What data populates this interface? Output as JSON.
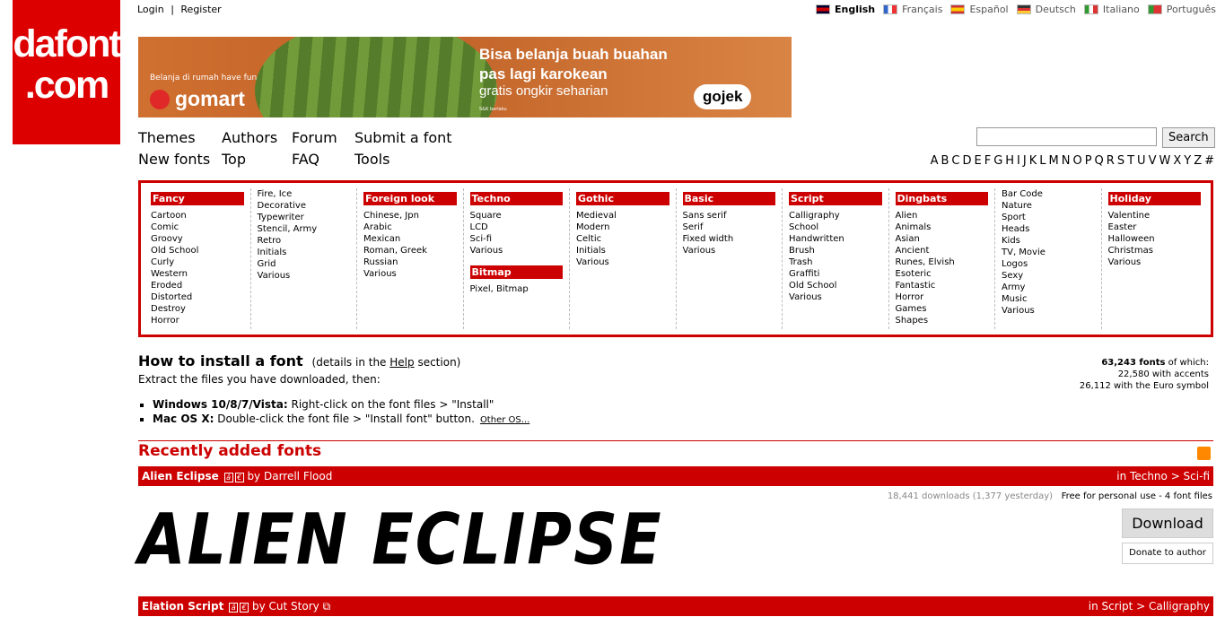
{
  "logo": {
    "line1": "dafont",
    ".line2": ".com",
    "line2": ".com"
  },
  "top_links": {
    "login": "Login",
    "sep": "|",
    "register": "Register"
  },
  "languages": [
    {
      "label": "English",
      "selected": true
    },
    {
      "label": "Français",
      "selected": false
    },
    {
      "label": "Español",
      "selected": false
    },
    {
      "label": "Deutsch",
      "selected": false
    },
    {
      "label": "Italiano",
      "selected": false
    },
    {
      "label": "Português",
      "selected": false
    }
  ],
  "banner": {
    "small": "Belanja di rumah have fun",
    "brand": "gomart",
    "headline1": "Bisa belanja buah buahan",
    "headline2": "pas lagi karokean",
    "sub": "gratis ongkir seharian",
    "gojek": "gojek",
    "tiny": "S&K berlaku"
  },
  "nav": {
    "themes": "Themes",
    "authors": "Authors",
    "forum": "Forum",
    "submit": "Submit a font",
    "newfonts": "New fonts",
    "top": "Top",
    "faq": "FAQ",
    "tools": "Tools"
  },
  "search": {
    "placeholder": "",
    "button": "Search"
  },
  "alphabet": [
    "A",
    "B",
    "C",
    "D",
    "E",
    "F",
    "G",
    "H",
    "I",
    "J",
    "K",
    "L",
    "M",
    "N",
    "O",
    "P",
    "Q",
    "R",
    "S",
    "T",
    "U",
    "V",
    "W",
    "X",
    "Y",
    "Z",
    "#"
  ],
  "categories": {
    "fancy": {
      "title": "Fancy",
      "items": [
        "Cartoon",
        "Comic",
        "Groovy",
        "Old School",
        "Curly",
        "Western",
        "Eroded",
        "Distorted",
        "Destroy",
        "Horror"
      ]
    },
    "fancy2": {
      "items": [
        "Fire, Ice",
        "Decorative",
        "Typewriter",
        "Stencil, Army",
        "Retro",
        "Initials",
        "Grid",
        "Various"
      ]
    },
    "foreign": {
      "title": "Foreign look",
      "items": [
        "Chinese, Jpn",
        "Arabic",
        "Mexican",
        "Roman, Greek",
        "Russian",
        "Various"
      ]
    },
    "techno": {
      "title": "Techno",
      "items": [
        "Square",
        "LCD",
        "Sci-fi",
        "Various"
      ]
    },
    "bitmap": {
      "title": "Bitmap",
      "items": [
        "Pixel, Bitmap"
      ]
    },
    "gothic": {
      "title": "Gothic",
      "items": [
        "Medieval",
        "Modern",
        "Celtic",
        "Initials",
        "Various"
      ]
    },
    "basic": {
      "title": "Basic",
      "items": [
        "Sans serif",
        "Serif",
        "Fixed width",
        "Various"
      ]
    },
    "script": {
      "title": "Script",
      "items": [
        "Calligraphy",
        "School",
        "Handwritten",
        "Brush",
        "Trash",
        "Graffiti",
        "Old School",
        "Various"
      ]
    },
    "dingbats": {
      "title": "Dingbats",
      "items": [
        "Alien",
        "Animals",
        "Asian",
        "Ancient",
        "Runes, Elvish",
        "Esoteric",
        "Fantastic",
        "Horror",
        "Games",
        "Shapes"
      ]
    },
    "dingbats2": {
      "items": [
        "Bar Code",
        "Nature",
        "Sport",
        "Heads",
        "Kids",
        "TV, Movie",
        "Logos",
        "Sexy",
        "Army",
        "Music",
        "Various"
      ]
    },
    "holiday": {
      "title": "Holiday",
      "items": [
        "Valentine",
        "Easter",
        "Halloween",
        "Christmas",
        "Various"
      ]
    }
  },
  "howto": {
    "title": "How to install a font",
    "details_pre": "(details in the",
    "details_link": "Help",
    "details_post": "section)",
    "extract": "Extract the files you have downloaded, then:",
    "win_label": "Windows 10/8/7/Vista:",
    "win_text": "Right-click on the font files > \"Install\"",
    "mac_label": "Mac OS X:",
    "mac_text": "Double-click the font file > \"Install font\" button.",
    "other": "Other OS..."
  },
  "stats": {
    "count": "63,243 fonts",
    "of_which": "of which:",
    "accents": "22,580 with accents",
    "euro": "26,112 with the Euro symbol"
  },
  "recent": {
    "title": "Recently added fonts"
  },
  "font1": {
    "name": "Alien Eclipse",
    "by": "by Darrell Flood",
    "cat": "in Techno > Sci-fi",
    "downloads": "18,441 downloads (1,377 yesterday)",
    "license": "Free for personal use - 4 font files",
    "preview": "ALIEN ECLIPSE",
    "download": "Download",
    "donate": "Donate to author"
  },
  "font2": {
    "name": "Elation Script",
    "by": "by Cut Story",
    "cat": "in Script > Calligraphy"
  }
}
